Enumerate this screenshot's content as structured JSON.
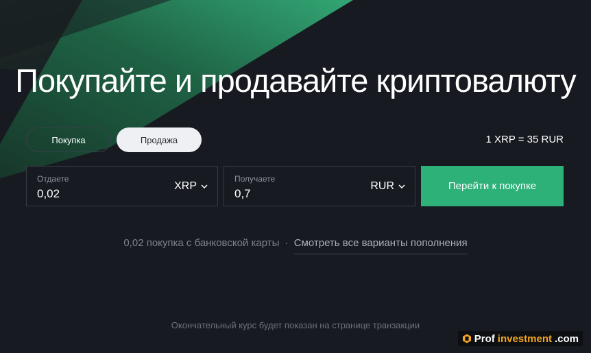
{
  "hero": {
    "title": "Покупайте и продавайте криптовалюту"
  },
  "tabs": {
    "buy": "Покупка",
    "sell": "Продажа",
    "active": "sell"
  },
  "rate": "1 XRP = 35 RUR",
  "give": {
    "label": "Отдаете",
    "value": "0,02",
    "currency": "XRP"
  },
  "receive": {
    "label": "Получаете",
    "value": "0,7",
    "currency": "RUR"
  },
  "cta": {
    "label": "Перейти к покупке"
  },
  "info": {
    "text": "0,02 покупка с банковской карты",
    "separator": "·",
    "link": "Смотреть все варианты пополнения"
  },
  "disclaimer": "Окончательный курс будет показан на странице транзакции",
  "watermark": {
    "part1": "Prof",
    "part2": "investment",
    "part3": ".com"
  },
  "colors": {
    "background": "#171b21",
    "accent": "#2eb079",
    "wedge_dark": "#1b4a35",
    "wedge_light": "#2a9d6b",
    "watermark_accent": "#f5a623"
  }
}
